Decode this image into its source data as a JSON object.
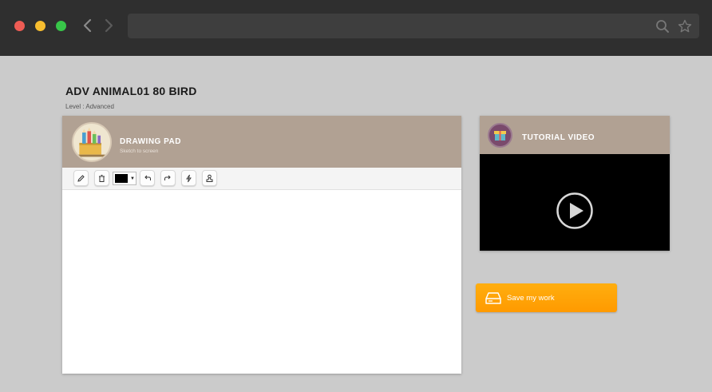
{
  "page": {
    "title": "ADV ANIMAL01 80 BIRD",
    "level": "Level : Advanced"
  },
  "drawing_pad": {
    "title": "DRAWING PAD",
    "subtitle": "Sketch to screen",
    "tools": [
      "pencil-icon",
      "trash-icon",
      "undo-icon",
      "redo-icon",
      "lightning-icon",
      "stamp-icon"
    ],
    "current_color": "#000000"
  },
  "tutorial": {
    "title": "TUTORIAL VIDEO"
  },
  "save": {
    "label": "Save my work"
  },
  "colors": {
    "header_bg": "#b1a193",
    "accent_orange": "#ff9a00",
    "chrome": "#2f2f2f"
  }
}
